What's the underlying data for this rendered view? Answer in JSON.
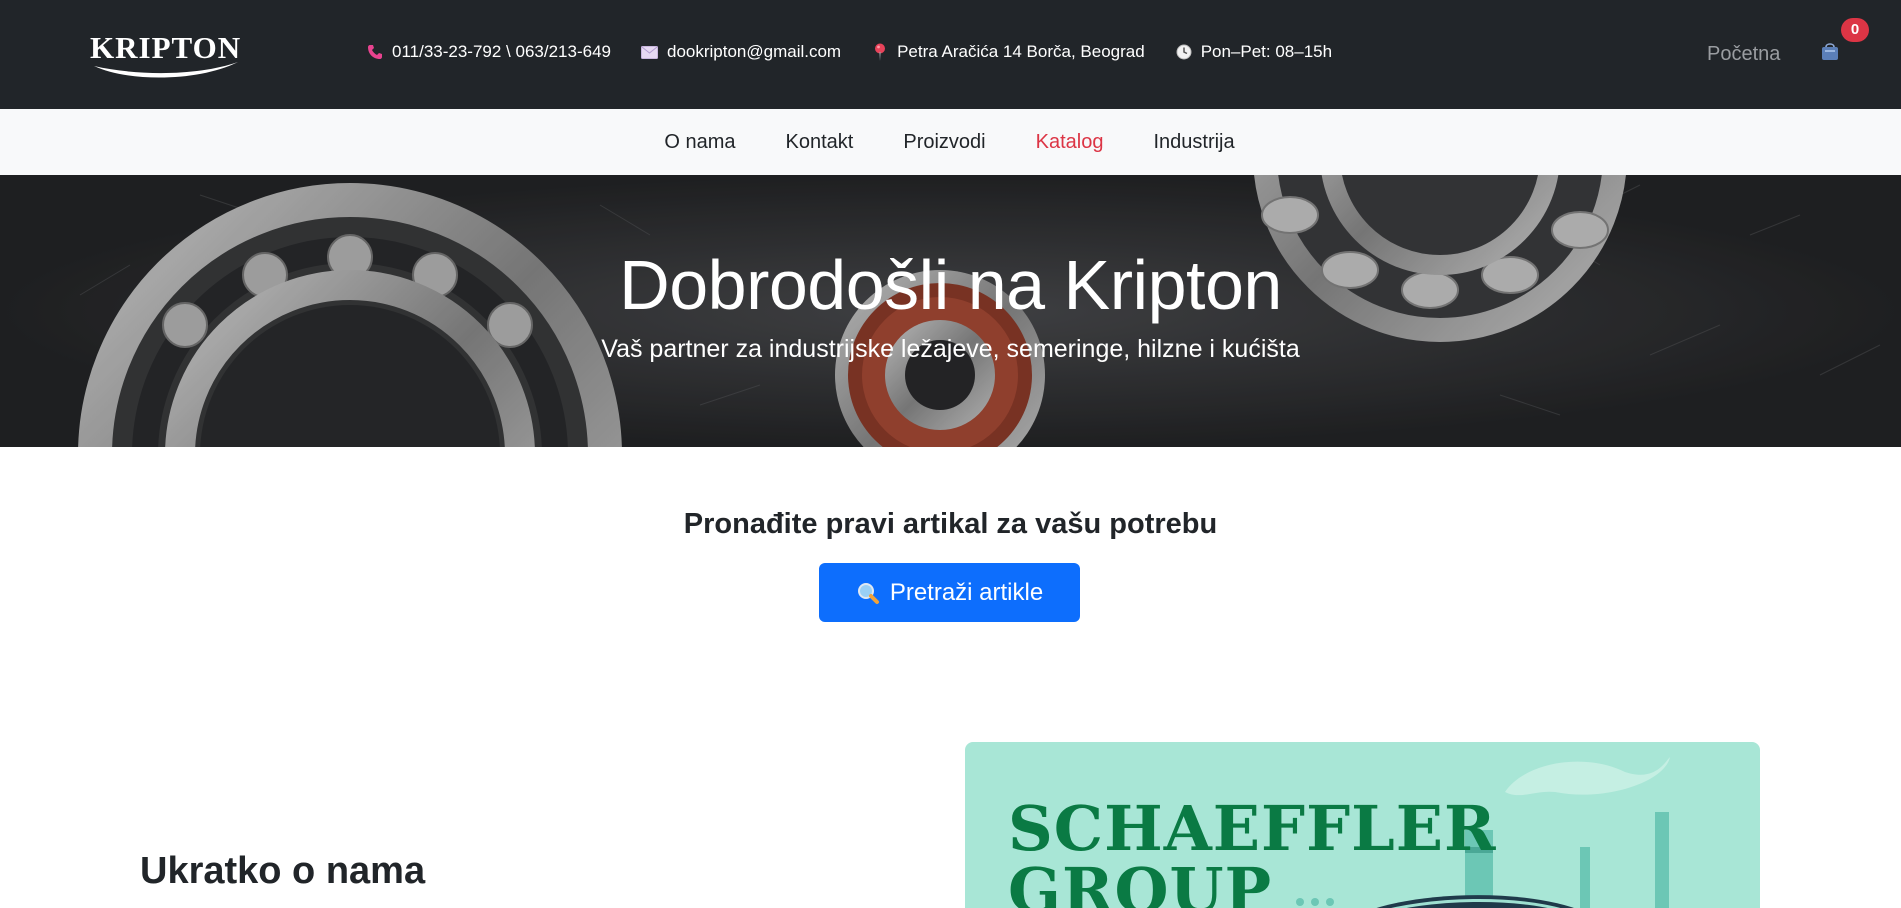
{
  "header": {
    "logo_text": "KRIPTON",
    "contacts": [
      {
        "icon": "phone-icon",
        "text": "011/33-23-792 \\ 063/213-649"
      },
      {
        "icon": "envelope-icon",
        "text": "dookripton@gmail.com"
      },
      {
        "icon": "map-pin-icon",
        "text": "Petra Aračića 14 Borča, Beograd"
      },
      {
        "icon": "clock-icon",
        "text": "Pon–Pet: 08–15h"
      }
    ],
    "home_link": "Početna",
    "cart_count": "0",
    "colors": {
      "background": "#212529",
      "badge": "#dc3545"
    }
  },
  "nav": {
    "items": [
      {
        "label": "O nama"
      },
      {
        "label": "Kontakt"
      },
      {
        "label": "Proizvodi"
      },
      {
        "label": "Katalog",
        "active": true
      },
      {
        "label": "Industrija"
      }
    ],
    "colors": {
      "background": "#f8f9fa",
      "active": "#dc3545"
    }
  },
  "hero": {
    "title": "Dobrodošli na Kripton",
    "subtitle": "Vaš partner za industrijske ležajeve, semeringe, hilzne i kućišta"
  },
  "search": {
    "heading": "Pronađite pravi artikal za vašu potrebu",
    "button_label": "Pretraži artikle",
    "button_icon": "magnifier-icon",
    "button_color": "#0d6efd"
  },
  "about": {
    "heading": "Ukratko o nama"
  },
  "brand_card": {
    "line1": "SCHAEFFLER",
    "line2": "GROUP",
    "colors": {
      "background": "#a8e6d6",
      "text": "#0a7a44"
    }
  }
}
